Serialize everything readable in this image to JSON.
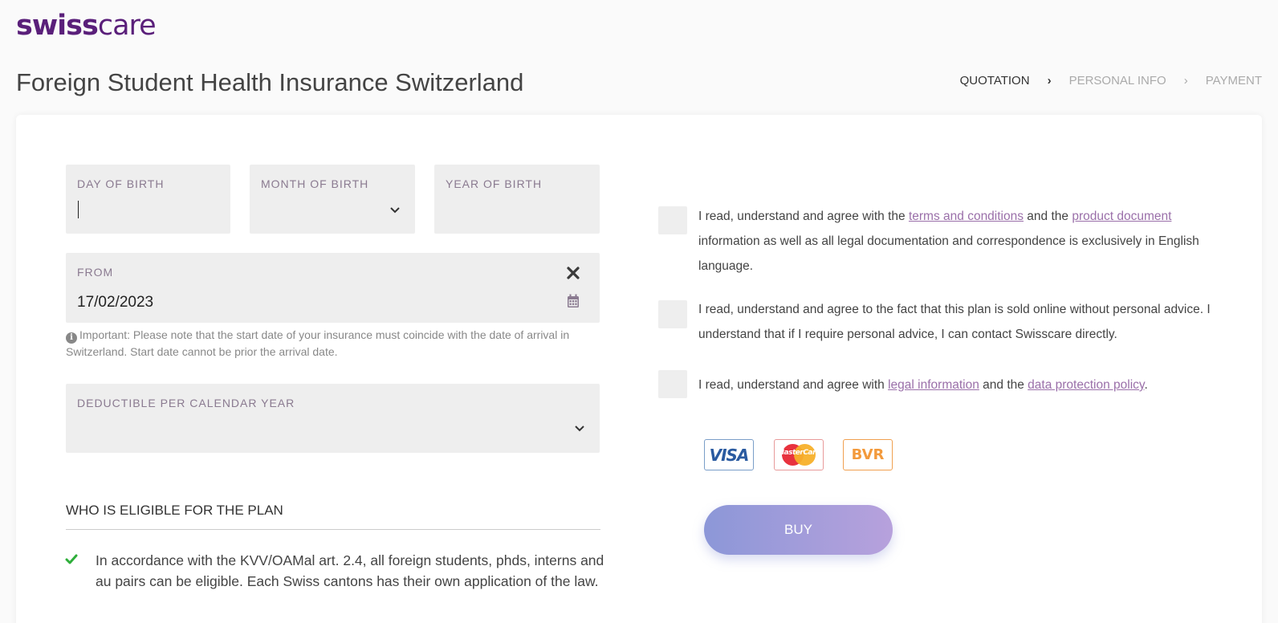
{
  "brand": {
    "logo_bold": "swiss",
    "logo_light": "care"
  },
  "page_title": "Foreign Student Health Insurance Switzerland",
  "steps": [
    {
      "label": "QUOTATION",
      "active": true
    },
    {
      "label": "PERSONAL INFO",
      "active": false
    },
    {
      "label": "PAYMENT",
      "active": false
    }
  ],
  "form": {
    "day_of_birth": {
      "label": "DAY OF BIRTH",
      "value": ""
    },
    "month_of_birth": {
      "label": "MONTH OF BIRTH",
      "value": ""
    },
    "year_of_birth": {
      "label": "YEAR OF BIRTH",
      "value": ""
    },
    "from": {
      "label": "FROM",
      "value": "17/02/2023"
    },
    "note": "Important: Please note that the start date of your insurance must coincide with the date of arrival in Switzerland. Start date cannot be prior the arrival date.",
    "deductible": {
      "label": "DEDUCTIBLE PER CALENDAR YEAR",
      "value": ""
    }
  },
  "eligibility": {
    "title": "WHO IS ELIGIBLE FOR THE PLAN",
    "items": [
      "In accordance with the KVV/OAMal art. 2.4, all foreign students, phds, interns and au pairs can be eligible. Each Swiss cantons has their own application of the law."
    ]
  },
  "agreements": {
    "a1": {
      "t1": "I read, understand and agree with the ",
      "link1": "terms and conditions",
      "t2": " and the ",
      "link2": "product document",
      "t3": " information as well as all legal documentation and correspondence is exclusively in English language."
    },
    "a2": {
      "t1": "I read, understand and agree to the fact that this plan is sold online without personal advice. I understand that if I require personal advice, I can contact Swisscare directly."
    },
    "a3": {
      "t1": "I read, understand and agree with ",
      "link1": "legal information",
      "t2": " and the ",
      "link2": "data protection policy",
      "t3": "."
    }
  },
  "payment_methods": {
    "visa": "VISA",
    "mastercard": "MasterCard",
    "bvr": "BVR"
  },
  "buy_label": "BUY",
  "colors": {
    "brand": "#5a1f7a",
    "link": "#9a6fa9",
    "buy_start": "#8c97d8",
    "buy_end": "#b7a1dc"
  }
}
